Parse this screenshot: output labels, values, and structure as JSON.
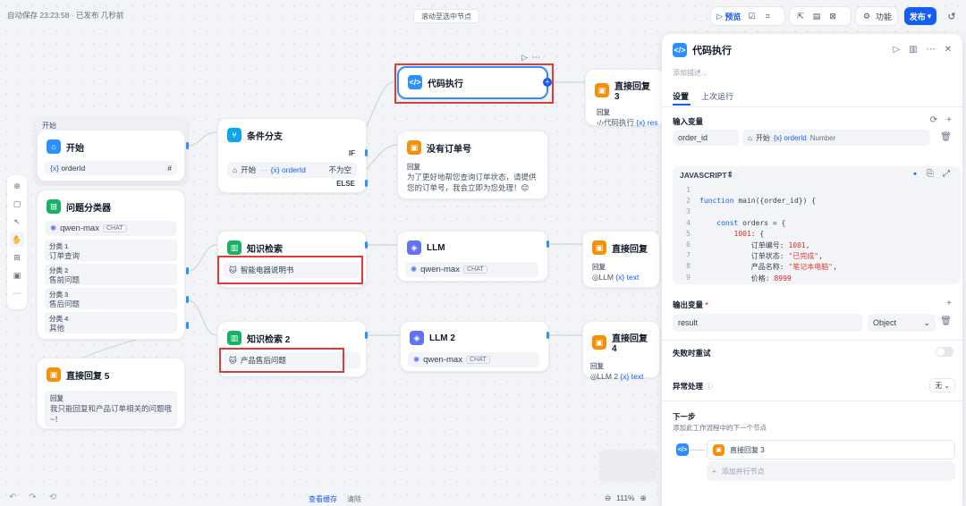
{
  "topbar": {
    "status": "自动保存 23:23:58 · 已发布 几秒前",
    "scroll_to_selected": "滚动至选中节点",
    "preview": "预览",
    "features": "功能",
    "publish": "发布"
  },
  "nodes": {
    "start": {
      "group": "开始",
      "title": "开始",
      "var": "orderId",
      "var_prefix": "{x}",
      "hash": "#"
    },
    "classifier": {
      "title": "问题分类器",
      "model": "qwen-max",
      "chat_tag": "CHAT",
      "classes": [
        {
          "label": "分类 1",
          "text": "订单查询"
        },
        {
          "label": "分类 2",
          "text": "售前问题"
        },
        {
          "label": "分类 3",
          "text": "售后问题"
        },
        {
          "label": "分类 4",
          "text": "其他"
        }
      ]
    },
    "reply5": {
      "title": "直接回复 5",
      "label": "回复",
      "text": "我只能回复和产品订单相关的问题哦~！"
    },
    "if_branch": {
      "title": "条件分支",
      "if": "IF",
      "else": "ELSE",
      "cond_node": "开始",
      "cond_var": "{x} orderId",
      "cond_op": "不为空",
      "dots": "···"
    },
    "knowledge1": {
      "title": "知识检索",
      "kb": "智能电器说明书"
    },
    "knowledge2": {
      "title": "知识检索 2",
      "kb": "产品售后问题"
    },
    "code_exec": {
      "title": "代码执行"
    },
    "no_order": {
      "title": "没有订单号",
      "label": "回复",
      "text": "为了更好地帮您查询订单状态，请提供您的订单号，我会立即为您处理！😊"
    },
    "reply3": {
      "title": "直接回复 3",
      "label": "回复",
      "var": "代码执行",
      "var2": "{x} res"
    },
    "llm1": {
      "title": "LLM",
      "model": "qwen-max",
      "chat_tag": "CHAT"
    },
    "llm2": {
      "title": "LLM 2",
      "model": "qwen-max",
      "chat_tag": "CHAT"
    },
    "reply_llm": {
      "title": "直接回复",
      "label": "回复",
      "var": "LLM",
      "var2": "{x} text"
    },
    "reply4": {
      "title": "直接回复 4",
      "label": "回复",
      "var": "LLM 2",
      "var2": "{x} text"
    }
  },
  "panel": {
    "title": "代码执行",
    "desc_placeholder": "添加描述...",
    "tabs": [
      "设置",
      "上次运行"
    ],
    "input_vars_title": "输入变量",
    "input_name": "order_id",
    "input_node": "开始",
    "input_var": "{x} orderId",
    "input_type": "Number",
    "lang": "JAVASCRIPT",
    "code_lines": [
      {
        "n": "1",
        "t": ""
      },
      {
        "n": "2",
        "t": "function main({order_id}) {"
      },
      {
        "n": "3",
        "t": ""
      },
      {
        "n": "4",
        "t": "    const orders = {"
      },
      {
        "n": "5",
        "t": "        1001: {"
      },
      {
        "n": "6",
        "t": "            订单编号: 1001,"
      },
      {
        "n": "7",
        "t": "            订单状态: \"已完成\","
      },
      {
        "n": "8",
        "t": "            产品名称: \"笔记本电脑\","
      },
      {
        "n": "9",
        "t": "            价格: 8999"
      }
    ],
    "output_title": "输出变量",
    "output_name": "result",
    "output_type": "Object",
    "retry": "失败时重试",
    "error_handling": "异常处理",
    "error_value": "无",
    "next_title": "下一步",
    "next_desc": "添加此工作流程中的下一个节点",
    "next_node": "直接回复 3",
    "add_parallel": "添加并行节点"
  },
  "bottom": {
    "view_cache": "查看缓存",
    "clear": "清除",
    "zoom": "111%"
  }
}
